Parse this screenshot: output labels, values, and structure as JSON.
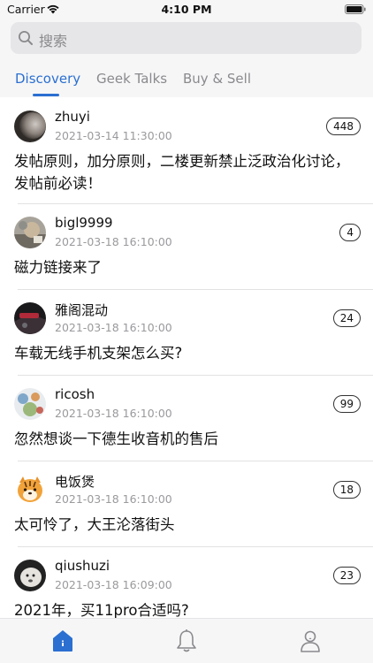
{
  "status_bar": {
    "carrier": "Carrier",
    "time": "4:10 PM"
  },
  "search": {
    "placeholder": "搜索"
  },
  "tabs": [
    {
      "label": "Discovery",
      "active": true
    },
    {
      "label": "Geek Talks",
      "active": false
    },
    {
      "label": "Buy & Sell",
      "active": false
    }
  ],
  "posts": [
    {
      "author": "zhuyi",
      "time": "2021-03-14 11:30:00",
      "count": "448",
      "title": "发帖原则，加分原则，二楼更新禁止泛政治化讨论，发帖前必读！"
    },
    {
      "author": "bigl9999",
      "time": "2021-03-18 16:10:00",
      "count": "4",
      "title": "磁力链接来了"
    },
    {
      "author": "雅阁混动",
      "time": "2021-03-18 16:10:00",
      "count": "24",
      "title": "车载无线手机支架怎么买?"
    },
    {
      "author": "ricosh",
      "time": "2021-03-18 16:10:00",
      "count": "99",
      "title": "忽然想谈一下德生收音机的售后"
    },
    {
      "author": "电饭煲",
      "time": "2021-03-18 16:10:00",
      "count": "18",
      "title": "太可怜了，大王沦落街头"
    },
    {
      "author": "qiushuzi",
      "time": "2021-03-18 16:09:00",
      "count": "23",
      "title": "2021年，买11pro合适吗?"
    }
  ],
  "tab_bar": {
    "items": [
      "home-icon",
      "bell-icon",
      "profile-icon"
    ]
  },
  "colors": {
    "accent": "#2b6fd1",
    "background": "#f6f6f7"
  }
}
